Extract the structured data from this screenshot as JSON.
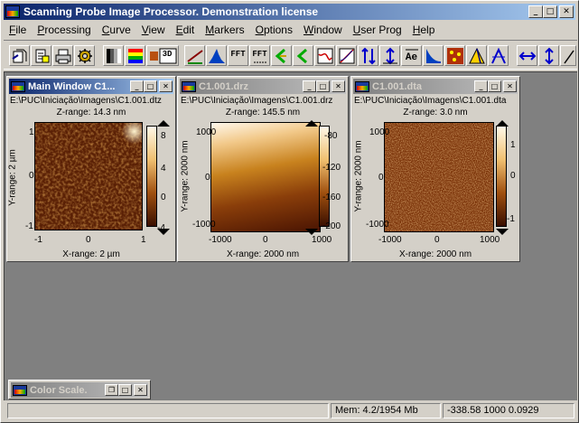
{
  "app": {
    "title": "Scanning Probe Image Processor. Demonstration license",
    "window_buttons": {
      "minimize": "_",
      "maximize": "□",
      "close": "✕"
    }
  },
  "menu": [
    {
      "label": "File",
      "underline": "F",
      "rest": "ile"
    },
    {
      "label": "Processing",
      "underline": "P",
      "rest": "rocessing"
    },
    {
      "label": "Curve",
      "underline": "C",
      "rest": "urve"
    },
    {
      "label": "View",
      "underline": "V",
      "rest": "iew"
    },
    {
      "label": "Edit",
      "underline": "E",
      "rest": "dit"
    },
    {
      "label": "Markers",
      "underline": "M",
      "rest": "arkers"
    },
    {
      "label": "Options",
      "underline": "O",
      "rest": "ptions"
    },
    {
      "label": "Window",
      "underline": "W",
      "rest": "indow"
    },
    {
      "label": "User Prog",
      "underline": "U",
      "rest": "ser Prog"
    },
    {
      "label": "Help",
      "underline": "H",
      "rest": "elp"
    }
  ],
  "toolbar": {
    "labels": {
      "fft1": "FFT",
      "fft2": "FFT",
      "ae": "Ae",
      "view3d": "3D"
    },
    "icons": [
      "open-icon",
      "open-folder-icon",
      "print-icon",
      "settings-gear-icon",
      "grayscale-icon",
      "color-palette-icon",
      "view-3d-icon",
      "slope-icon",
      "histogram-icon",
      "fft-icon",
      "fft-filter-icon",
      "rotate-left-icon",
      "rotate-right-icon",
      "profile-icon",
      "curve-icon",
      "height-distribution-icon",
      "height-arrow-icon",
      "ae-icon",
      "bearing-icon",
      "particle-icon",
      "grain-icon",
      "angle-icon",
      "horizontal-arrow-icon",
      "vertical-arrow-icon",
      "pen-icon"
    ]
  },
  "windows": [
    {
      "title": "Main Window C1...",
      "path": "E:\\PUC\\Iniciação\\Imagens\\C1.001.dtz",
      "z_range": "Z-range: 14.3 nm",
      "x_range": "X-range: 2 µm",
      "y_range": "Y-range: 2 µm",
      "x_ticks": [
        "-1",
        "0",
        "1"
      ],
      "y_ticks": [
        "1",
        "0",
        "-1"
      ],
      "scale_ticks": [
        "8",
        "4",
        "0",
        "-4"
      ],
      "active": true
    },
    {
      "title": "C1.001.drz",
      "path": "E:\\PUC\\Iniciação\\Imagens\\C1.001.drz",
      "z_range": "Z-range: 145.5 nm",
      "x_range": "X-range: 2000 nm",
      "y_range": "Y-range: 2000 nm",
      "x_ticks": [
        "-1000",
        "0",
        "1000"
      ],
      "y_ticks": [
        "1000",
        "0",
        "-1000"
      ],
      "scale_ticks": [
        "-80",
        "-120",
        "-160",
        "-200"
      ],
      "active": false
    },
    {
      "title": "C1.001.dta",
      "path": "E:\\PUC\\Iniciação\\Imagens\\C1.001.dta",
      "z_range": "Z-range: 3.0 nm",
      "x_range": "X-range: 2000 nm",
      "y_range": "Y-range: 2000 nm",
      "x_ticks": [
        "-1000",
        "0",
        "1000"
      ],
      "y_ticks": [
        "1000",
        "0",
        "-1000"
      ],
      "scale_ticks": [
        "1",
        "0",
        "-1"
      ],
      "active": false
    }
  ],
  "color_scale_window": {
    "title": "Color Scale.",
    "buttons": {
      "restore": "❐",
      "maximize": "□",
      "close": "✕"
    }
  },
  "status": {
    "left": "",
    "memory": "Mem: 4.2/1954 Mb",
    "coords": "-338.58 1000 0.0929"
  },
  "colors": {
    "title_active": "#0a246a",
    "mdi_background": "#808080",
    "afm_dark": "#3a0f00",
    "afm_mid": "#a0500f",
    "afm_light": "#fff8e8"
  }
}
